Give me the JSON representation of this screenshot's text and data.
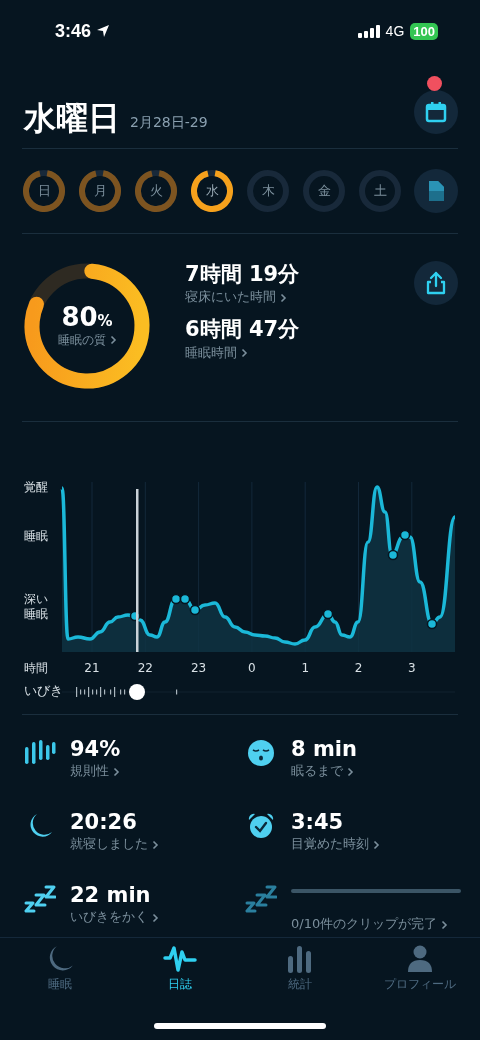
{
  "status_bar": {
    "time": "3:46",
    "network": "4G",
    "battery": "100"
  },
  "header": {
    "title": "水曜日",
    "date_range": "2月28日-29",
    "calendar_badge": true
  },
  "days": [
    {
      "label": "日",
      "recorded": true,
      "selected": false
    },
    {
      "label": "月",
      "recorded": true,
      "selected": false
    },
    {
      "label": "火",
      "recorded": true,
      "selected": false
    },
    {
      "label": "水",
      "recorded": true,
      "selected": true
    },
    {
      "label": "木",
      "recorded": false,
      "selected": false
    },
    {
      "label": "金",
      "recorded": false,
      "selected": false
    },
    {
      "label": "土",
      "recorded": false,
      "selected": false
    }
  ],
  "summary": {
    "quality": {
      "value": "80",
      "unit": "%",
      "label": "睡眠の質"
    },
    "metrics": [
      {
        "value": "7時間 19分",
        "label": "寝床にいた時間"
      },
      {
        "value": "6時間 47分",
        "label": "睡眠時間"
      }
    ]
  },
  "sleep_graph": {
    "y_labels": [
      "覚醒",
      "睡眠",
      "深い睡眠"
    ],
    "x_label": "時間",
    "x_ticks": [
      "21",
      "22",
      "23",
      "0",
      "1",
      "2",
      "3"
    ],
    "snore_label": "いびき"
  },
  "stats": [
    {
      "kind": "regularity",
      "value": "94%",
      "label": "規則性"
    },
    {
      "kind": "fall_asleep",
      "value": "8 min",
      "label": "眠るまで"
    },
    {
      "kind": "bedtime",
      "value": "20:26",
      "label": "就寝しました"
    },
    {
      "kind": "wake",
      "value": "3:45",
      "label": "目覚めた時刻"
    },
    {
      "kind": "snore",
      "value": "22 min",
      "label": "いびきをかく"
    },
    {
      "kind": "clips",
      "level": 0,
      "label": "0/10件のクリップが完了"
    }
  ],
  "tabs": [
    {
      "label": "睡眠",
      "selected": false
    },
    {
      "label": "日誌",
      "selected": true
    },
    {
      "label": "統計",
      "selected": false
    },
    {
      "label": "プロフィール",
      "selected": false
    }
  ]
}
